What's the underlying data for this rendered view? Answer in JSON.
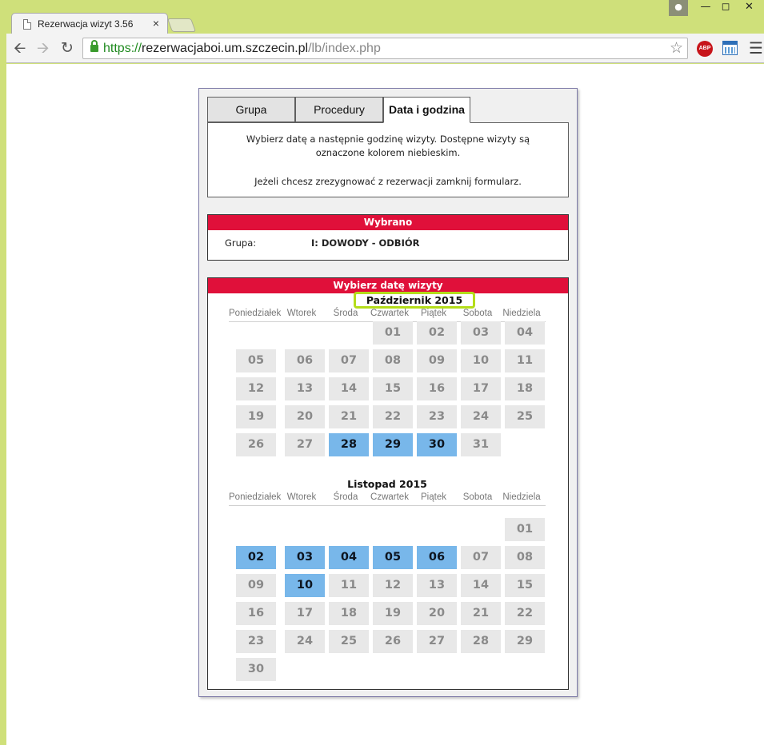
{
  "browser": {
    "tab_title": "Rezerwacja wizyt 3.56",
    "tab_close": "×",
    "url_scheme": "https://",
    "url_host": "rezerwacjaboi.um.szczecin.pl",
    "url_path": "/lb/index.php",
    "abp_label": "ABP",
    "icons": [
      "back-icon",
      "forward-icon",
      "reload-icon",
      "lock-icon",
      "star-icon",
      "adblock-icon",
      "calendar-icon",
      "menu-icon"
    ]
  },
  "tabs": [
    "Grupa",
    "Procedury",
    "Data i godzina"
  ],
  "info": {
    "line1": "Wybierz datę a następnie godzinę wizyty. Dostępne wizyty są oznaczone kolorem niebieskim.",
    "line2": "Jeżeli chcesz zrezygnować z rezerwacji zamknij formularz."
  },
  "selected": {
    "header": "Wybrano",
    "label": "Grupa:",
    "value": "I: DOWODY - ODBIÓR"
  },
  "calendar": {
    "header": "Wybierz datę wizyty",
    "weekdays": [
      "Poniedziałek",
      "Wtorek",
      "Środa",
      "Czwartek",
      "Piątek",
      "Sobota",
      "Niedziela"
    ],
    "months": [
      {
        "title": "Październik 2015",
        "first_col": 3,
        "days": 31,
        "available": [
          28,
          29,
          30
        ]
      },
      {
        "title": "Listopad 2015",
        "first_col": 6,
        "days": 30,
        "available": [
          2,
          3,
          4,
          5,
          6,
          10
        ]
      }
    ]
  },
  "colors": {
    "header_red": "#e0103a",
    "available_blue": "#78b7ea",
    "highlight_green": "#b4dd1a"
  }
}
